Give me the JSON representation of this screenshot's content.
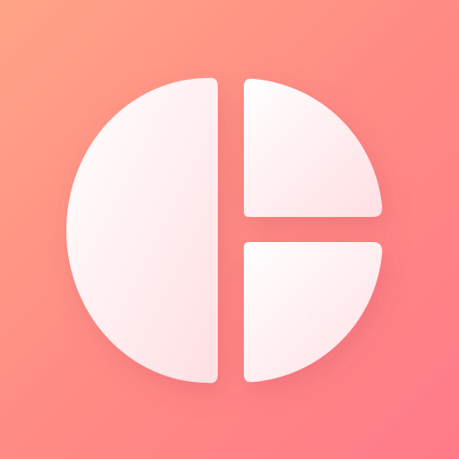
{
  "app_icon": {
    "icon": "pie-chart-icon",
    "colors": {
      "background_start": "#ffa486",
      "background_mid": "#ff8b84",
      "background_end": "#ff7a88",
      "segment_light": "#ffffff",
      "segment_shade": "#ffdfe3"
    }
  }
}
